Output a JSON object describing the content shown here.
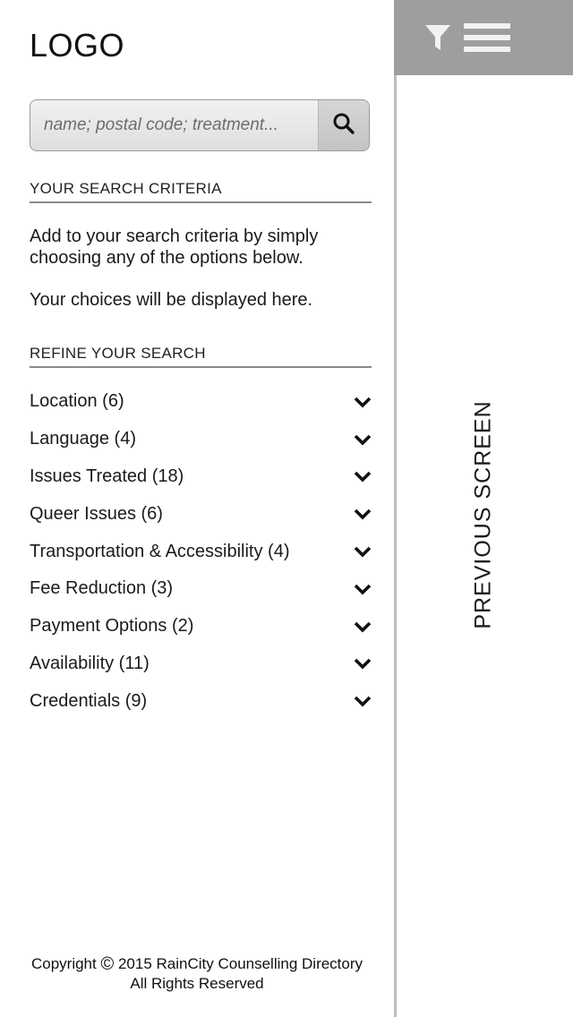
{
  "brand": {
    "logo_text": "LOGO"
  },
  "search": {
    "placeholder": "name; postal code; treatment..."
  },
  "criteria": {
    "heading": "YOUR SEARCH CRITERIA",
    "instructions": "Add to your search criteria by simply choosing any of the options below.",
    "empty_state": "Your choices will be displayed here."
  },
  "refine": {
    "heading": "REFINE YOUR SEARCH",
    "filters": [
      {
        "label": "Location (6)"
      },
      {
        "label": "Language (4)"
      },
      {
        "label": "Issues Treated (18)"
      },
      {
        "label": "Queer Issues (6)"
      },
      {
        "label": "Transportation & Accessibility (4)"
      },
      {
        "label": "Fee Reduction (3)"
      },
      {
        "label": "Payment Options (2)"
      },
      {
        "label": "Availability (11)"
      },
      {
        "label": "Credentials (9)"
      }
    ]
  },
  "footer": {
    "copyright_prefix": "Copyright",
    "copyright_symbol": "©",
    "copyright_rest": "2015 RainCity Counselling Directory",
    "rights": "All Rights Reserved"
  },
  "side_panel": {
    "label": "PREVIOUS SCREEN"
  },
  "icons": {
    "filter": "filter-icon",
    "menu": "menu-icon",
    "search": "search-icon",
    "chevron": "chevron-down-icon"
  },
  "colors": {
    "topbar": "#9e9e9e",
    "icon_light": "#f2f2f2",
    "divider": "#bcbcbc"
  }
}
